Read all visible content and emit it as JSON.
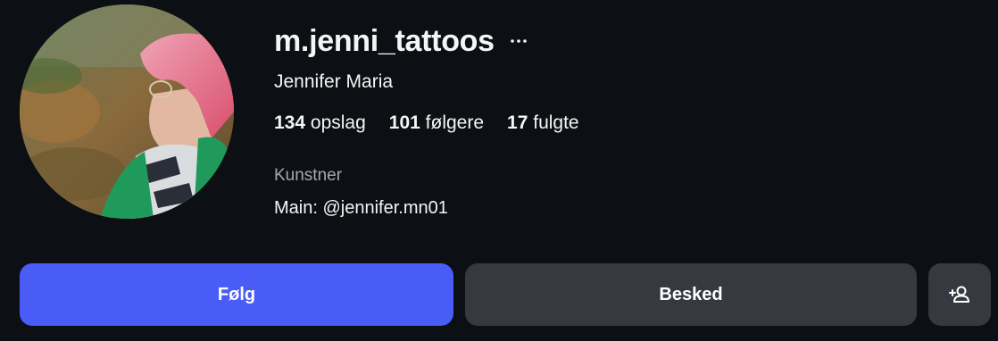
{
  "profile": {
    "username": "m.jenni_tattoos",
    "full_name": "Jennifer Maria",
    "avatar_description": "profile-photo",
    "stats": [
      {
        "count": "134",
        "label": "opslag"
      },
      {
        "count": "101",
        "label": "følgere"
      },
      {
        "count": "17",
        "label": "fulgte"
      }
    ],
    "category": "Kunstner",
    "bio": "Main: @jennifer.mn01"
  },
  "actions": {
    "follow_label": "Følg",
    "message_label": "Besked",
    "add_user_icon": "add-user-icon",
    "more_icon": "more-horizontal-icon"
  },
  "colors": {
    "background": "#0c1014",
    "follow_button": "#4a5cf6",
    "secondary_button": "#363a40",
    "muted_text": "#a8a8a8"
  }
}
